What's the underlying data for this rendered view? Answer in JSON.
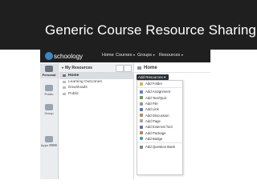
{
  "slide": {
    "title": "Generic Course Resource Sharing"
  },
  "topbar": {
    "logo_text": "schoology",
    "nav": [
      "Home",
      "Courses",
      "Groups",
      "Resources"
    ],
    "caret": "▾"
  },
  "leftnav": {
    "items": [
      "Personal",
      "Public",
      "Group",
      "Apps"
    ]
  },
  "my_resources": {
    "title": "My Resources",
    "items": [
      "Home",
      "Learning Outcomes",
      "Downloads",
      "Public"
    ]
  },
  "main": {
    "title": "Home",
    "add_button": "Add Resources ▾",
    "menu": {
      "first": "Add Folder",
      "group": [
        "Add Assignment",
        "Add Test/Quiz",
        "Add File",
        "Add Link",
        "Add Discussion",
        "Add Page",
        "Add External Tool",
        "Add Package",
        "Add Badge"
      ],
      "last": "Add Question Bank"
    }
  },
  "colors": {
    "banner": "#1f1f1f",
    "topbar": "#1f1f1f",
    "logo_badge": "#3b87c7",
    "add_button": "#2b2f33"
  }
}
